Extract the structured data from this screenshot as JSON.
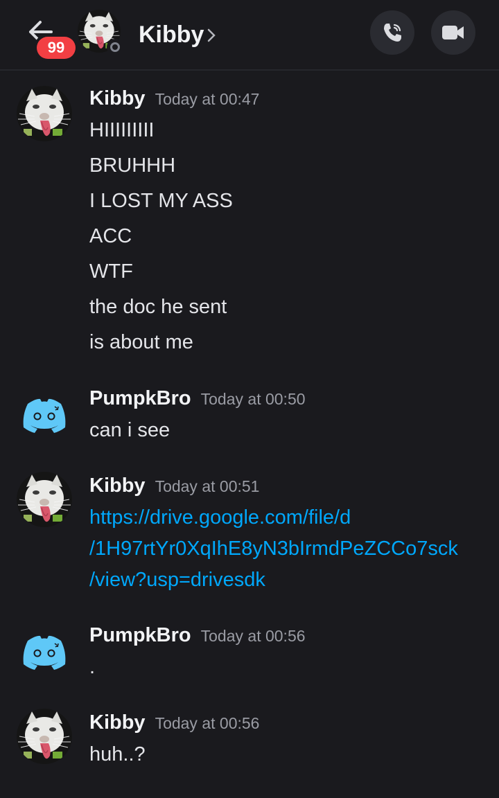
{
  "header": {
    "back_badge": "99",
    "contact_name": "Kibby",
    "chevron_glyph": "›",
    "buttons": {
      "call": "phone-icon",
      "video": "video-camera-icon"
    }
  },
  "colors": {
    "background": "#1a1a1e",
    "badge": "#f23f43",
    "link": "#00a8fc",
    "discord_blurple_light": "#5fc8f7"
  },
  "messages": [
    {
      "author": "Kibby",
      "timestamp": "Today at 00:47",
      "avatar": "cat-avatar",
      "lines": [
        "HIIIIIIIII",
        "BRUHHH",
        "I LOST MY ASS",
        "ACC",
        "WTF",
        "the doc he sent",
        "is about me"
      ]
    },
    {
      "author": "PumpkBro",
      "timestamp": "Today at 00:50",
      "avatar": "discord-default-avatar",
      "lines": [
        "can i see"
      ]
    },
    {
      "author": "Kibby",
      "timestamp": "Today at 00:51",
      "avatar": "cat-avatar",
      "link_lines": [
        "https://drive.google.com/file/d",
        "/1H97rtYr0XqIhE8yN3bIrmdPeZCCo7sck",
        "/view?usp=drivesdk"
      ]
    },
    {
      "author": "PumpkBro",
      "timestamp": "Today at 00:56",
      "avatar": "discord-default-avatar",
      "lines": [
        "."
      ]
    },
    {
      "author": "Kibby",
      "timestamp": "Today at 00:56",
      "avatar": "cat-avatar",
      "lines": [
        "huh..?"
      ]
    }
  ]
}
